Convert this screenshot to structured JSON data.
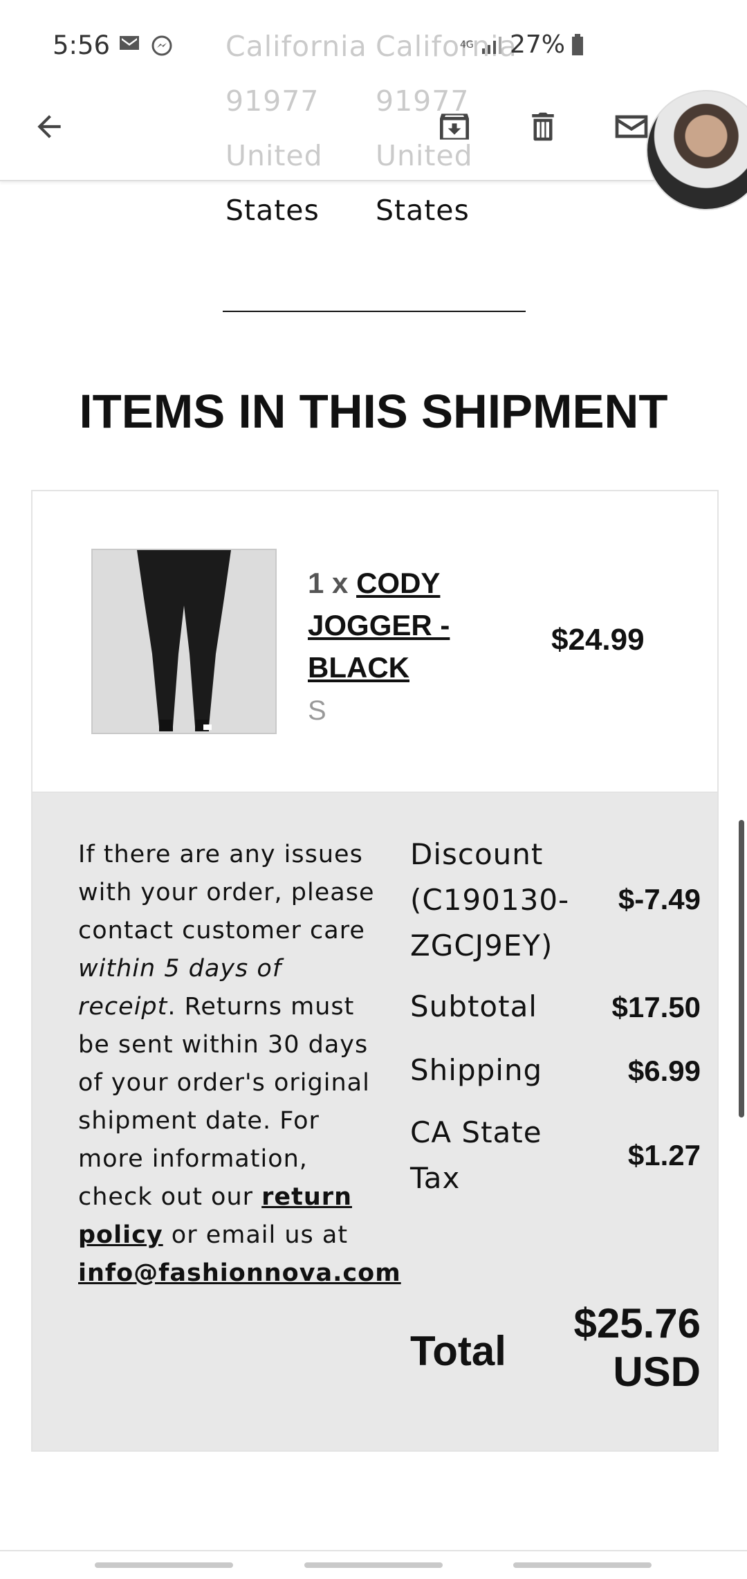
{
  "status": {
    "time": "5:56",
    "battery": "27%",
    "network": "4G"
  },
  "address": {
    "col1": [
      "California",
      "91977",
      "United",
      "States"
    ],
    "col2": [
      "California",
      "91977",
      "United",
      "States"
    ]
  },
  "section": {
    "title": "ITEMS IN THIS SHIPMENT"
  },
  "item": {
    "qty": "1 x",
    "name": "CODY JOGGER - BLACK",
    "size": "S",
    "price": "$24.99"
  },
  "policy": {
    "text1": "If there are any issues with your order, please contact customer care ",
    "italic": "within 5 days of receipt",
    "text2": ". Returns must be sent within 30 days of your order's original shipment date. For more information, check out our ",
    "link1": "return policy",
    "text3": " or email us at ",
    "email": "info@fashionnova.com"
  },
  "totals": {
    "discount_label": "Discount (C190130-ZGCJ9EY)",
    "discount_value": "$-7.49",
    "subtotal_label": "Subtotal",
    "subtotal_value": "$17.50",
    "shipping_label": "Shipping",
    "shipping_value": "$6.99",
    "tax_label": "CA State Tax",
    "tax_value": "$1.27",
    "total_label": "Total",
    "total_value": "$25.76 USD"
  },
  "icons": {
    "back": "arrow-left-icon",
    "archive": "archive-icon",
    "delete": "trash-icon",
    "mark_unread": "mail-icon"
  }
}
